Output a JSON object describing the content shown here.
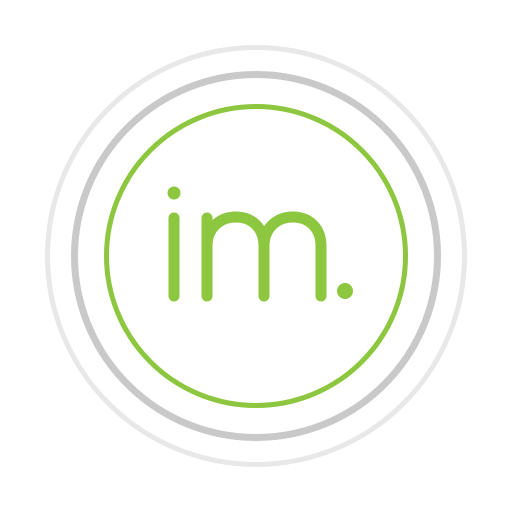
{
  "logo": {
    "wordmark": "im.",
    "colors": {
      "accent": "#8dc63f",
      "ring_outer": "#e8e8e8",
      "ring_middle": "#c9c9c9",
      "background": "#ffffff"
    }
  }
}
